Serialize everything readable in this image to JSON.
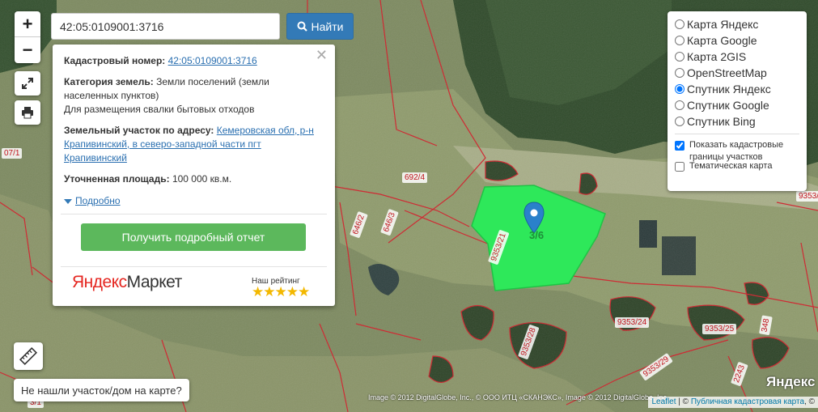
{
  "search": {
    "value": "42:05:0109001:3716",
    "button_label": "Найти"
  },
  "zoom": {
    "in_label": "+",
    "out_label": "−"
  },
  "popup": {
    "cad_label": "Кадастровый номер:",
    "cad_value": "42:05:0109001:3716",
    "cat_label": "Категория земель:",
    "cat_value": "Земли поселений (земли населенных пунктов)",
    "cat_use": "Для размещения свалки бытовых отходов",
    "addr_label": "Земельный участок по адресу:",
    "addr_value": "Кемеровская обл, р-н Крапивинский, в северо-западной части пгт Крапивинский",
    "area_label": "Уточненная площадь:",
    "area_value": "100 000 кв.м.",
    "more_label": "Подробно",
    "report_label": "Получить подробный отчет",
    "market_brand_a": "Яндекс",
    "market_brand_b": "Маркет",
    "rating_label": "Наш рейтинг",
    "stars": "★★★★★"
  },
  "layers": {
    "base": [
      {
        "label": "Карта Яндекс",
        "checked": false
      },
      {
        "label": "Карта Google",
        "checked": false
      },
      {
        "label": "Карта 2GIS",
        "checked": false
      },
      {
        "label": "OpenStreetMap",
        "checked": false
      },
      {
        "label": "Спутник Яндекс",
        "checked": true
      },
      {
        "label": "Спутник Google",
        "checked": false
      },
      {
        "label": "Спутник Bing",
        "checked": false
      }
    ],
    "overlay": [
      {
        "label": "Показать кадастровые границы участков",
        "checked": true
      },
      {
        "label": "Тематическая карта",
        "checked": false
      }
    ]
  },
  "not_found_label": "Не нашли участок/дом на карте?",
  "parcel_labels": [
    "692/4",
    "646/2",
    "646/3",
    "9353/21",
    "9353/24",
    "9353/25",
    "9353/28",
    "9353/29",
    "9353/",
    "348",
    "2243",
    "07/1",
    "3/1"
  ],
  "parcel_center_label": "3/6",
  "attribution": {
    "imagery": "Image © 2012 DigitalGlobe, Inc., © ООО ИТЦ «СКАНЭКС», Image © 2012 DigitalGlobe, Inc.",
    "leaflet": "Leaflet",
    "sep": " | © ",
    "pkk": "Публичная кадастровая карта",
    "tail": ", ©"
  },
  "yandex_logo": "Яндекс",
  "colors": {
    "parcel_fill": "#2ee85a",
    "boundary": "#d0202a",
    "button_blue": "#337ab7",
    "button_green": "#5cb85c"
  }
}
